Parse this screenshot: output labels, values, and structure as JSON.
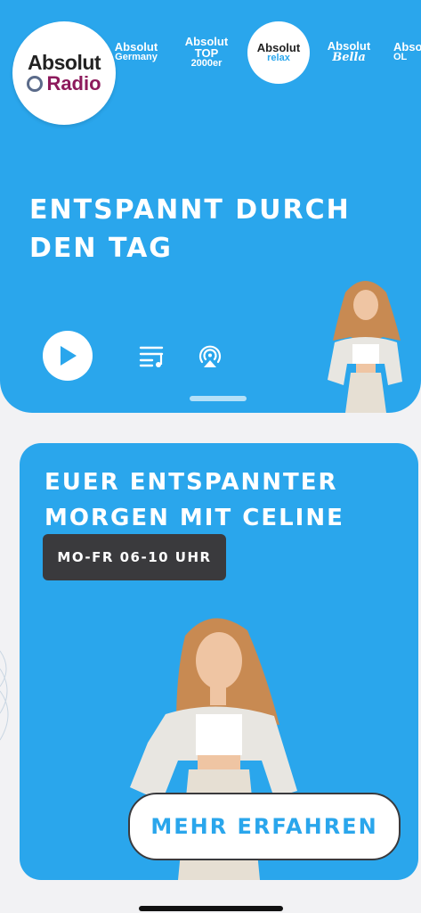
{
  "stations": {
    "main": {
      "line1": "Absolut",
      "line2": "Radio"
    },
    "germany": {
      "line1": "Absolut",
      "line2": "Germany"
    },
    "top": {
      "line1": "Absolut",
      "line2": "TOP",
      "line3": "2000er"
    },
    "relax": {
      "line1": "Absolut",
      "line2": "relax"
    },
    "bella": {
      "line1": "Absolut",
      "line2": "Bella"
    },
    "partial": {
      "line1": "Abso",
      "line2": "OL"
    }
  },
  "hero": {
    "title": "ENTSPANNT DURCH DEN TAG",
    "icons": {
      "play": "play-icon",
      "playlist": "playlist-icon",
      "airplay": "airplay-icon"
    }
  },
  "card": {
    "title": "EUER ENTSPANNTER MORGEN MIT CELINE",
    "time": "MO-FR 06-10 UHR",
    "button": "MEHR ERFAHREN"
  },
  "colors": {
    "accent": "#2aa6ec",
    "dark": "#3a3a3d",
    "brand": "#8d1a5c"
  }
}
